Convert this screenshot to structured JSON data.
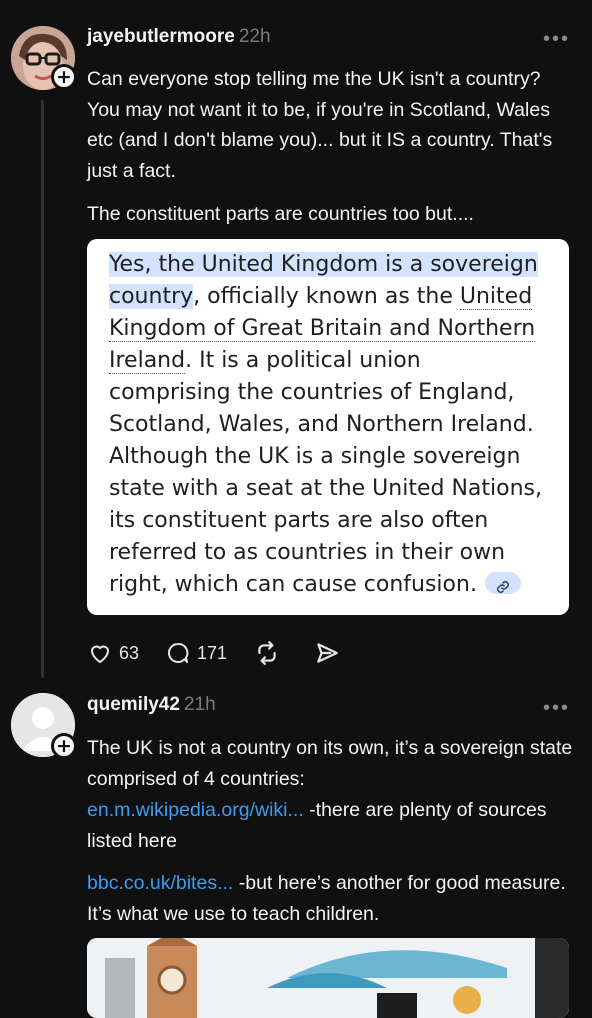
{
  "post1": {
    "username": "jayebutlermoore",
    "time": "22h",
    "paragraph1": "Can everyone stop telling me the UK isn't a country?  You may not want it to be, if you're in Scotland, Wales etc (and I don't blame you)... but it IS a country.  That's just a fact.",
    "paragraph2": "The constituent parts are countries too but....",
    "quote": {
      "highlight": "Yes, the United Kingdom is a sovereign country",
      "after_highlight": ", officially known as the ",
      "link_text": "United Kingdom of Great Britain and Northern Ireland",
      "rest": ". It is a political union comprising the countries of England, Scotland, Wales, and Northern Ireland. Although the UK is a single sovereign state with a seat at the United Nations, its constituent parts are also often referred to as countries in their own right, which can cause confusion."
    },
    "actions": {
      "likes": "63",
      "replies": "171"
    }
  },
  "post2": {
    "username": "quemily42",
    "time": "21h",
    "paragraph1": "The UK is not a country on its own, it’s a sovereign state comprised of 4 countries:",
    "link1": "en.m.wikipedia.org/wiki...",
    "link1_suffix": " -there are plenty of sources listed here",
    "link2": "bbc.co.uk/bites...",
    "link2_suffix": " -but here’s another for good measure. It’s what we use to teach children."
  },
  "icons": {
    "more": "more-dots-icon",
    "follow": "plus-icon",
    "like": "heart-icon",
    "reply": "comment-bubble-icon",
    "repost": "repost-icon",
    "share": "send-icon"
  },
  "colors": {
    "background": "#101010",
    "link": "#3a9df3",
    "highlight": "#d3e3fd"
  }
}
